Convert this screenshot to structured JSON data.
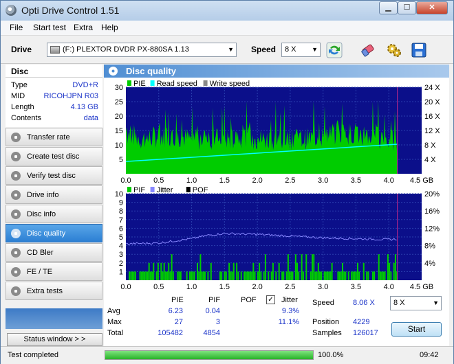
{
  "window": {
    "title": "Opti Drive Control 1.51"
  },
  "menu": [
    "File",
    "Start test",
    "Extra",
    "Help"
  ],
  "toolbar": {
    "drive_label": "Drive",
    "drive_value": "(F:)   PLEXTOR DVDR   PX-880SA 1.13",
    "speed_label": "Speed",
    "speed_value": "8 X"
  },
  "disc": {
    "header": "Disc",
    "rows": [
      {
        "key": "Type",
        "value": "DVD+R"
      },
      {
        "key": "MID",
        "value": "RICOHJPN R03"
      },
      {
        "key": "Length",
        "value": "4.13 GB"
      },
      {
        "key": "Contents",
        "value": "data"
      }
    ]
  },
  "nav": [
    {
      "label": "Transfer rate",
      "active": false
    },
    {
      "label": "Create test disc",
      "active": false
    },
    {
      "label": "Verify test disc",
      "active": false
    },
    {
      "label": "Drive info",
      "active": false
    },
    {
      "label": "Disc info",
      "active": false
    },
    {
      "label": "Disc quality",
      "active": true
    },
    {
      "label": "CD Bler",
      "active": false
    },
    {
      "label": "FE / TE",
      "active": false
    },
    {
      "label": "Extra tests",
      "active": false
    }
  ],
  "status_window_label": "Status window > >",
  "panel": {
    "title": "Disc quality"
  },
  "chart_data": [
    {
      "type": "area",
      "legend": [
        "PIE",
        "Read speed",
        "Write speed"
      ],
      "colors": {
        "PIE": "#00cc00",
        "Read speed": "#00ffff",
        "Write speed": "#888888"
      },
      "x_ticks": [
        "0.0",
        "0.5",
        "1.0",
        "1.5",
        "2.0",
        "2.5",
        "3.0",
        "3.5",
        "4.0",
        "4.5 GB"
      ],
      "xlim": [
        0,
        4.5
      ],
      "y_ticks": [
        "5",
        "10",
        "15",
        "20",
        "25",
        "30"
      ],
      "ylim": [
        0,
        30
      ],
      "y2_ticks": [
        "4 X",
        "8 X",
        "12 X",
        "16 X",
        "20 X",
        "24 X"
      ],
      "y2lim": [
        0,
        24
      ],
      "end_marker": 4.13,
      "pie_profile": {
        "x": [
          0,
          0.25,
          0.5,
          0.75,
          1.0,
          1.25,
          1.5,
          1.75,
          2.0,
          2.25,
          2.5,
          2.75,
          3.0,
          3.25,
          3.5,
          3.75,
          4.0,
          4.13
        ],
        "y": [
          14,
          12,
          13,
          13,
          12,
          12,
          12,
          12,
          12,
          12,
          12,
          12,
          13,
          14,
          14,
          13,
          12,
          10
        ]
      },
      "read_speed": {
        "x": [
          0,
          4.13
        ],
        "y": [
          3.4,
          8.2
        ]
      }
    },
    {
      "type": "bar",
      "legend": [
        "PIF",
        "Jitter",
        "POF"
      ],
      "colors": {
        "PIF": "#00cc00",
        "Jitter": "#8888ff",
        "POF": "#000000"
      },
      "x_ticks": [
        "0.0",
        "0.5",
        "1.0",
        "1.5",
        "2.0",
        "2.5",
        "3.0",
        "3.5",
        "4.0",
        "4.5 GB"
      ],
      "xlim": [
        0,
        4.5
      ],
      "y_ticks": [
        "1",
        "2",
        "3",
        "4",
        "5",
        "6",
        "7",
        "8",
        "9",
        "10"
      ],
      "ylim": [
        0,
        10
      ],
      "y2_ticks": [
        "4%",
        "8%",
        "12%",
        "16%",
        "20%"
      ],
      "y2lim": [
        0,
        20
      ],
      "end_marker": 4.13,
      "jitter": {
        "x": [
          0,
          0.5,
          1.0,
          1.25,
          1.5,
          2.0,
          2.5,
          3.0,
          3.5,
          4.0,
          4.13
        ],
        "y": [
          8.4,
          8.6,
          9.6,
          10.4,
          10.8,
          10.6,
          10.2,
          9.8,
          9.6,
          9.4,
          9.5
        ]
      }
    }
  ],
  "stats": {
    "headers": [
      "PIE",
      "PIF",
      "POF",
      "Jitter"
    ],
    "rows": [
      {
        "label": "Avg",
        "pie": "6.23",
        "pif": "0.04",
        "jitter": "9.3%"
      },
      {
        "label": "Max",
        "pie": "27",
        "pif": "3",
        "jitter": "11.1%"
      },
      {
        "label": "Total",
        "pie": "105482",
        "pif": "4854"
      }
    ],
    "jitter_checked": true,
    "speed_label": "Speed",
    "speed_value": "8.06 X",
    "speed_select": "8 X",
    "position_label": "Position",
    "position_value": "4229",
    "samples_label": "Samples",
    "samples_value": "126017",
    "start_label": "Start"
  },
  "statusbar": {
    "text": "Test completed",
    "progress_percent": 100,
    "progress_label": "100.0%",
    "time": "09:42"
  }
}
